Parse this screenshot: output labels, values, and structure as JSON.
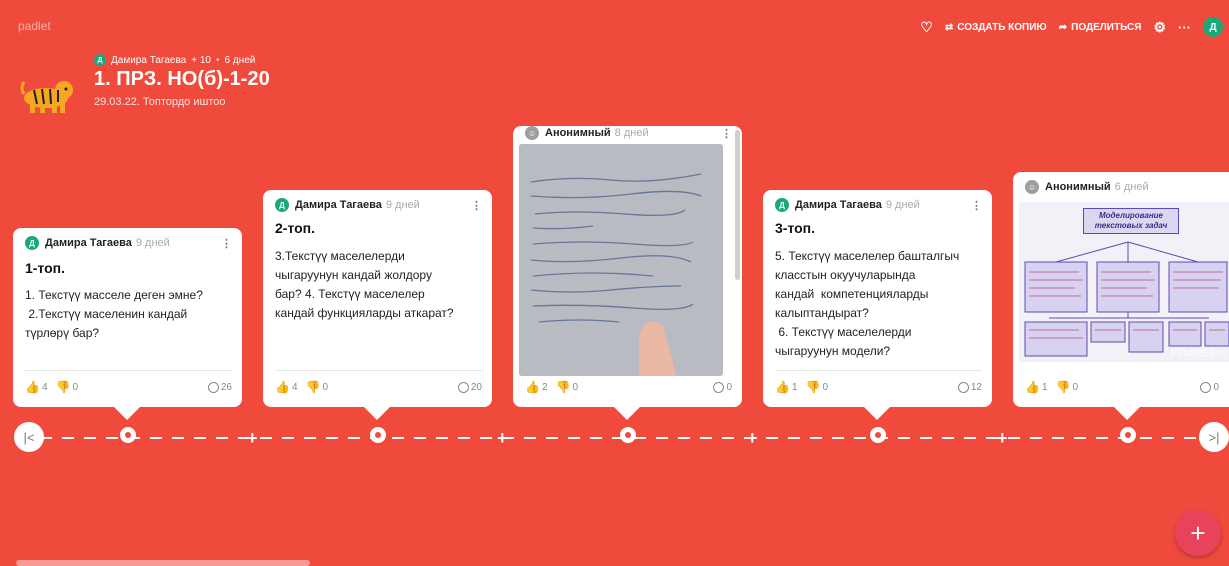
{
  "app": {
    "logo": "padlet"
  },
  "toolbar": {
    "heart_glyph": "♡",
    "copy_label": "СОЗДАТЬ КОПИЮ",
    "share_label": "ПОДЕЛИТЬСЯ",
    "gear_glyph": "⚙",
    "more_glyph": "···",
    "avatar_letter": "Д"
  },
  "board": {
    "author_avatar": "Д",
    "author": "Дамира Тагаева",
    "followers": "+ 10",
    "separator": "•",
    "age": "6 дней",
    "title": "1. ПРЗ. НО(б)-1-20",
    "subtitle": "29.03.22. Топтордо иштоо"
  },
  "posts": [
    {
      "avatar": "Д",
      "author": "Дамира Тагаева",
      "time": "9 дней",
      "title": "1-топ.",
      "body": [
        "1. Текстүү масселе деген эмне?",
        " 2.Текстүү маселенин кандай",
        "түрлөрү бар?"
      ],
      "likes": "4",
      "dislikes": "0",
      "comments": "26"
    },
    {
      "avatar": "Д",
      "author": "Дамира Тагаева",
      "time": "9 дней",
      "title": "2-топ.",
      "body": [
        "3.Текстүү маселелерди",
        "чыгаруунун кандай жолдору",
        "бар? 4. Текстүү маселелер",
        "кандай функцияларды аткарат?"
      ],
      "likes": "4",
      "dislikes": "0",
      "comments": "20"
    },
    {
      "author": "Анонимный",
      "time": "8 дней",
      "likes": "2",
      "dislikes": "0",
      "comments": "0"
    },
    {
      "avatar": "Д",
      "author": "Дамира Тагаева",
      "time": "9 дней",
      "title": "3-топ.",
      "body": [
        "5. Текстүү маселелер башталгыч",
        "класстын окуучуларында",
        "кандай  компетенцияларды",
        "калыптандырат?",
        " 6. Текстүү маселелерди",
        "чыгаруунун модели?"
      ],
      "likes": "1",
      "dislikes": "0",
      "comments": "12"
    },
    {
      "author": "Анонимный",
      "time": "6 дней",
      "likes": "1",
      "dislikes": "0",
      "comments": "0",
      "slide_title": "Моделирование текстовых задач",
      "watermark": "PPt4WEB.ru"
    }
  ],
  "timeline": {
    "prev_glyph": "|<",
    "next_glyph": ">|",
    "plus_glyph": "+"
  },
  "fab": {
    "glyph": "+"
  },
  "colors": {
    "background": "#f04a3c",
    "avatar": "#1aa879",
    "liked": "#6a4fd1",
    "fab": "#e8435b"
  }
}
